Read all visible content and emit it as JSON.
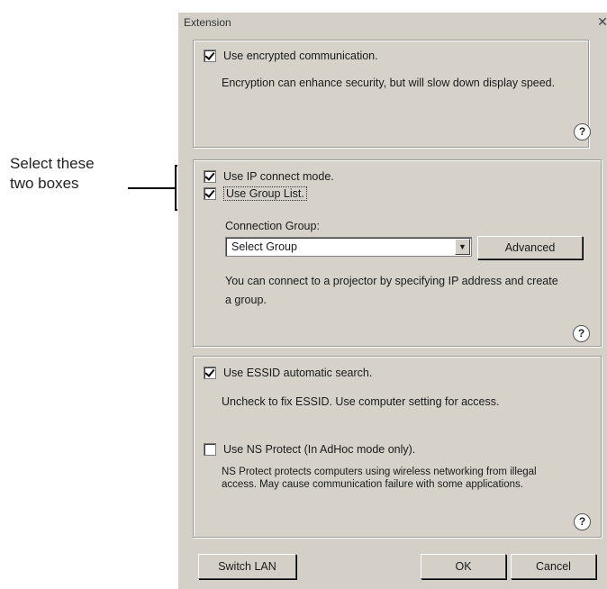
{
  "annotation": {
    "line1": "Select these",
    "line2": "two boxes"
  },
  "dialog": {
    "title": "Extension",
    "close_glyph": "✕",
    "encryption": {
      "checkbox_label": "Use encrypted communication.",
      "checked": true,
      "description": "Encryption can enhance security, but will slow down display speed."
    },
    "ip": {
      "ip_connect_label": "Use IP connect mode.",
      "ip_connect_checked": true,
      "group_list_label": "Use Group List.",
      "group_list_checked": true,
      "connection_group_label": "Connection Group:",
      "select_value": "Select Group",
      "advanced_label": "Advanced",
      "description": "You can connect to a projector by specifying IP address and create a group."
    },
    "wireless": {
      "essid_label": "Use ESSID automatic search.",
      "essid_checked": true,
      "essid_description": "Uncheck to fix ESSID. Use computer setting for access.",
      "ns_label": "Use NS Protect (In AdHoc mode only).",
      "ns_checked": false,
      "ns_description": "NS Protect protects computers using wireless networking from illegal access. May cause communication failure with some applications."
    },
    "help_glyph": "?",
    "buttons": {
      "switch_lan": "Switch LAN",
      "ok": "OK",
      "cancel": "Cancel"
    }
  }
}
